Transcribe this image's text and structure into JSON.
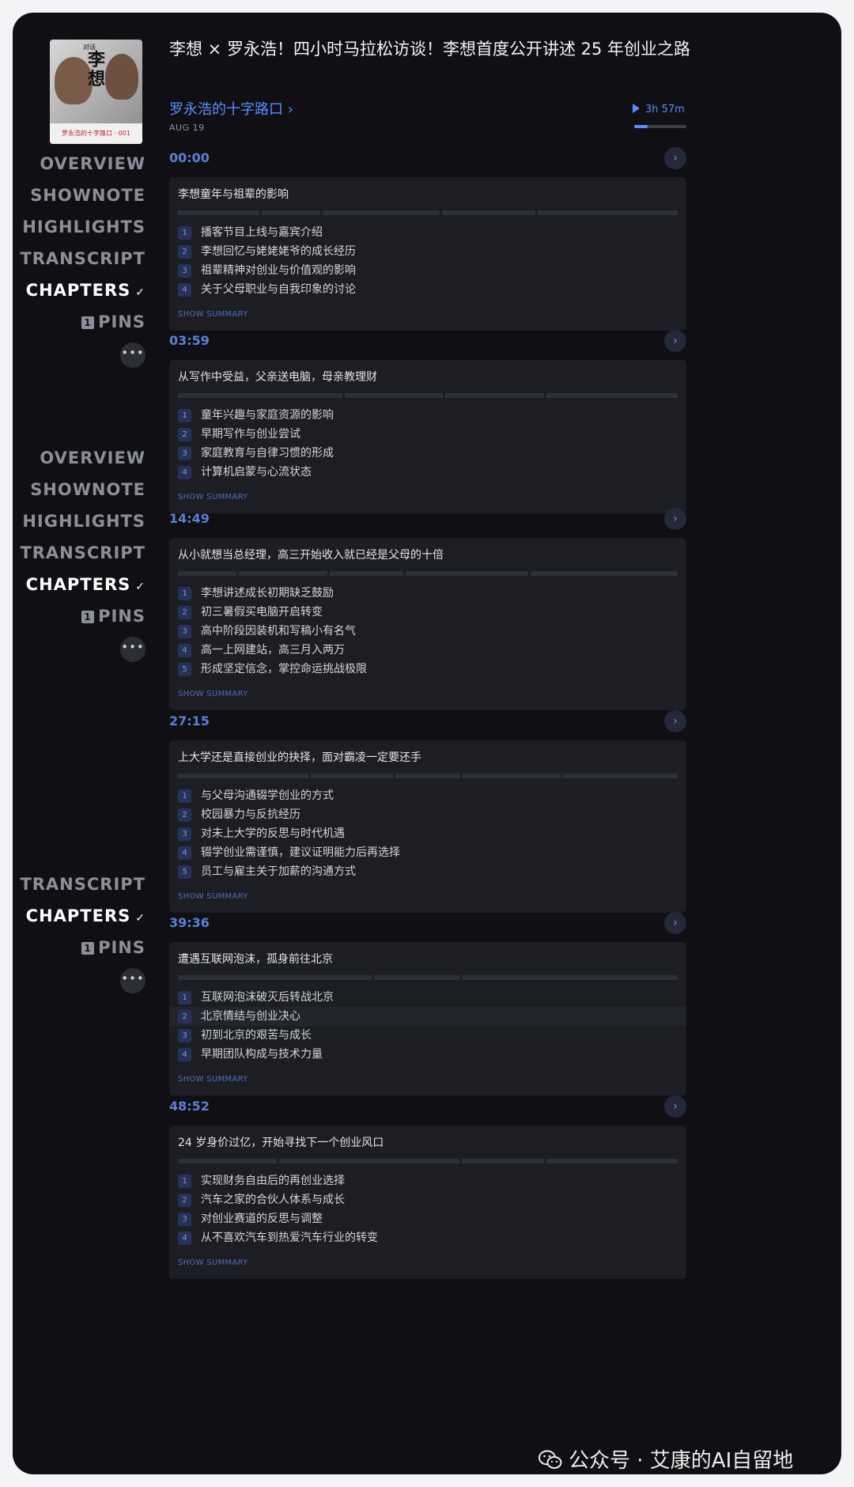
{
  "podcast": {
    "title": "李想 × 罗永浩！四小时马拉松访谈！李想首度公开讲述 25 年创业之路",
    "channel": "罗永浩的十字路口",
    "channel_chevron": "›",
    "date": "AUG 19",
    "duration": "3h 57m",
    "progress": 0.25,
    "cover": {
      "tag": "对话",
      "title": "李想",
      "footer": "罗永浩的十字路口 · 001"
    }
  },
  "nav": {
    "items": [
      "OVERVIEW",
      "SHOWNOTE",
      "HIGHLIGHTS",
      "TRANSCRIPT",
      "CHAPTERS"
    ],
    "active": "CHAPTERS",
    "check": "✓",
    "pins_count": "1",
    "pins_label": "PINS",
    "more": "•••"
  },
  "summary_label": "SHOW SUMMARY",
  "chapters": [
    {
      "time": "00:00",
      "title": "李想童年与祖辈的影响",
      "items": [
        "播客节目上线与嘉宾介绍",
        "李想回忆与姥姥姥爷的成长经历",
        "祖辈精神对创业与价值观的影响",
        "关于父母职业与自我印象的讨论"
      ]
    },
    {
      "time": "03:59",
      "title": "从写作中受益，父亲送电脑，母亲教理财",
      "items": [
        "童年兴趣与家庭资源的影响",
        "早期写作与创业尝试",
        "家庭教育与自律习惯的形成",
        "计算机启蒙与心流状态"
      ]
    },
    {
      "time": "14:49",
      "title": "从小就想当总经理，高三开始收入就已经是父母的十倍",
      "items": [
        "李想讲述成长初期缺乏鼓励",
        "初三暑假买电脑开启转变",
        "高中阶段因装机和写稿小有名气",
        "高一上网建站，高三月入两万",
        "形成坚定信念，掌控命运挑战极限"
      ]
    },
    {
      "time": "27:15",
      "title": "上大学还是直接创业的抉择，面对霸凌一定要还手",
      "items": [
        "与父母沟通辍学创业的方式",
        "校园暴力与反抗经历",
        "对未上大学的反思与时代机遇",
        "辍学创业需谨慎，建议证明能力后再选择",
        "员工与雇主关于加薪的沟通方式"
      ]
    },
    {
      "time": "39:36",
      "title": "遭遇互联网泡沫，孤身前往北京",
      "items": [
        "互联网泡沫破灭后转战北京",
        "北京情结与创业决心",
        "初到北京的艰苦与成长",
        "早期团队构成与技术力量"
      ]
    },
    {
      "time": "48:52",
      "title": "24 岁身价过亿，开始寻找下一个创业风口",
      "items": [
        "实现财务自由后的再创业选择",
        "汽车之家的合伙人体系与成长",
        "对创业赛道的反思与调整",
        "从不喜欢汽车到热爱汽车行业的转变"
      ]
    }
  ],
  "watermark": "公众号 · 艾康的AI自留地"
}
